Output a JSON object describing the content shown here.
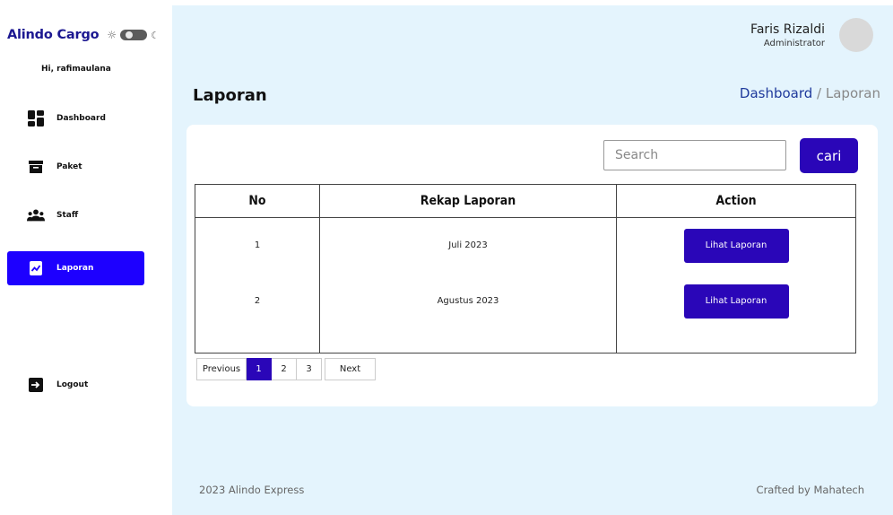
{
  "sidebar": {
    "brand": "Alindo Cargo",
    "greeting": "Hi, rafimaulana",
    "items": [
      {
        "label": "Dashboard",
        "icon": "dashboard-icon"
      },
      {
        "label": "Paket",
        "icon": "package-box-icon"
      },
      {
        "label": "Staff",
        "icon": "people-icon"
      },
      {
        "label": "Laporan",
        "icon": "report-chart-icon",
        "active": true
      }
    ],
    "logout_label": "Logout"
  },
  "header": {
    "user_name": "Faris Rizaldi",
    "user_role": "Administrator"
  },
  "page": {
    "title": "Laporan",
    "breadcrumb": {
      "link": "Dashboard",
      "separator": " / ",
      "current": "Laporan"
    }
  },
  "search": {
    "placeholder": "Search",
    "button_label": "cari"
  },
  "table": {
    "headers": [
      "No",
      "Rekap Laporan",
      "Action"
    ],
    "rows": [
      {
        "no": "1",
        "rekap": "Juli 2023",
        "action": "Lihat Laporan"
      },
      {
        "no": "2",
        "rekap": "Agustus 2023",
        "action": "Lihat Laporan"
      }
    ]
  },
  "pagination": {
    "previous": "Previous",
    "pages": [
      "1",
      "2",
      "3"
    ],
    "current": "1",
    "next": "Next"
  },
  "footer": {
    "left": "2023 Alindo Express",
    "right": "Crafted by Mahatech"
  },
  "colors": {
    "primary": "#2a06b8",
    "active_nav": "#1d00ff",
    "main_bg": "#e4f4fd",
    "brand": "#1c1891"
  }
}
